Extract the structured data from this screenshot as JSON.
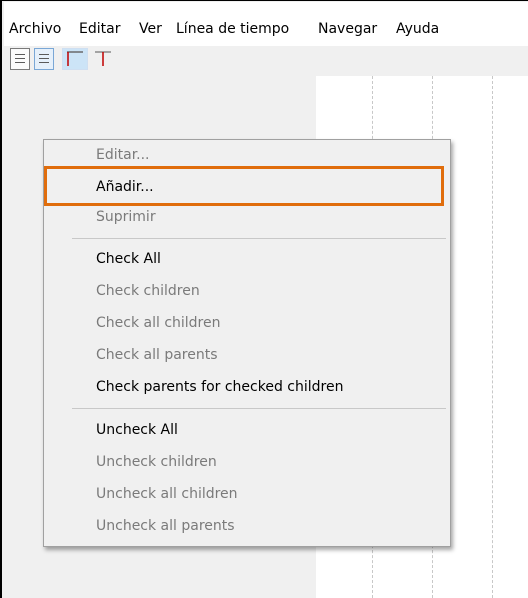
{
  "menubar": {
    "items": [
      "Archivo",
      "Editar",
      "Ver",
      "Línea de tiempo",
      "Navegar",
      "Ayuda"
    ]
  },
  "toolbar": {
    "buttons": [
      {
        "icon": "document-icon"
      },
      {
        "icon": "document-pressed-icon"
      },
      {
        "icon": "timeline-start-icon"
      },
      {
        "icon": "timeline-marker-icon"
      }
    ]
  },
  "context_menu": {
    "items": [
      {
        "label": "Editar...",
        "enabled": false
      },
      {
        "label": "Añadir...",
        "enabled": true,
        "highlighted": true
      },
      {
        "label": "Suprimir",
        "enabled": false
      },
      {
        "label": "Check All",
        "enabled": true
      },
      {
        "label": "Check children",
        "enabled": false
      },
      {
        "label": "Check all children",
        "enabled": false
      },
      {
        "label": "Check all parents",
        "enabled": false
      },
      {
        "label": "Check parents for checked children",
        "enabled": true
      },
      {
        "label": "Uncheck All",
        "enabled": true
      },
      {
        "label": "Uncheck children",
        "enabled": false
      },
      {
        "label": "Uncheck all children",
        "enabled": false
      },
      {
        "label": "Uncheck all parents",
        "enabled": false
      }
    ]
  },
  "colors": {
    "highlight_border": "#e06d0c",
    "toolbar_pressed": "#cce4f7",
    "timeline_icon_red": "#c00000"
  }
}
